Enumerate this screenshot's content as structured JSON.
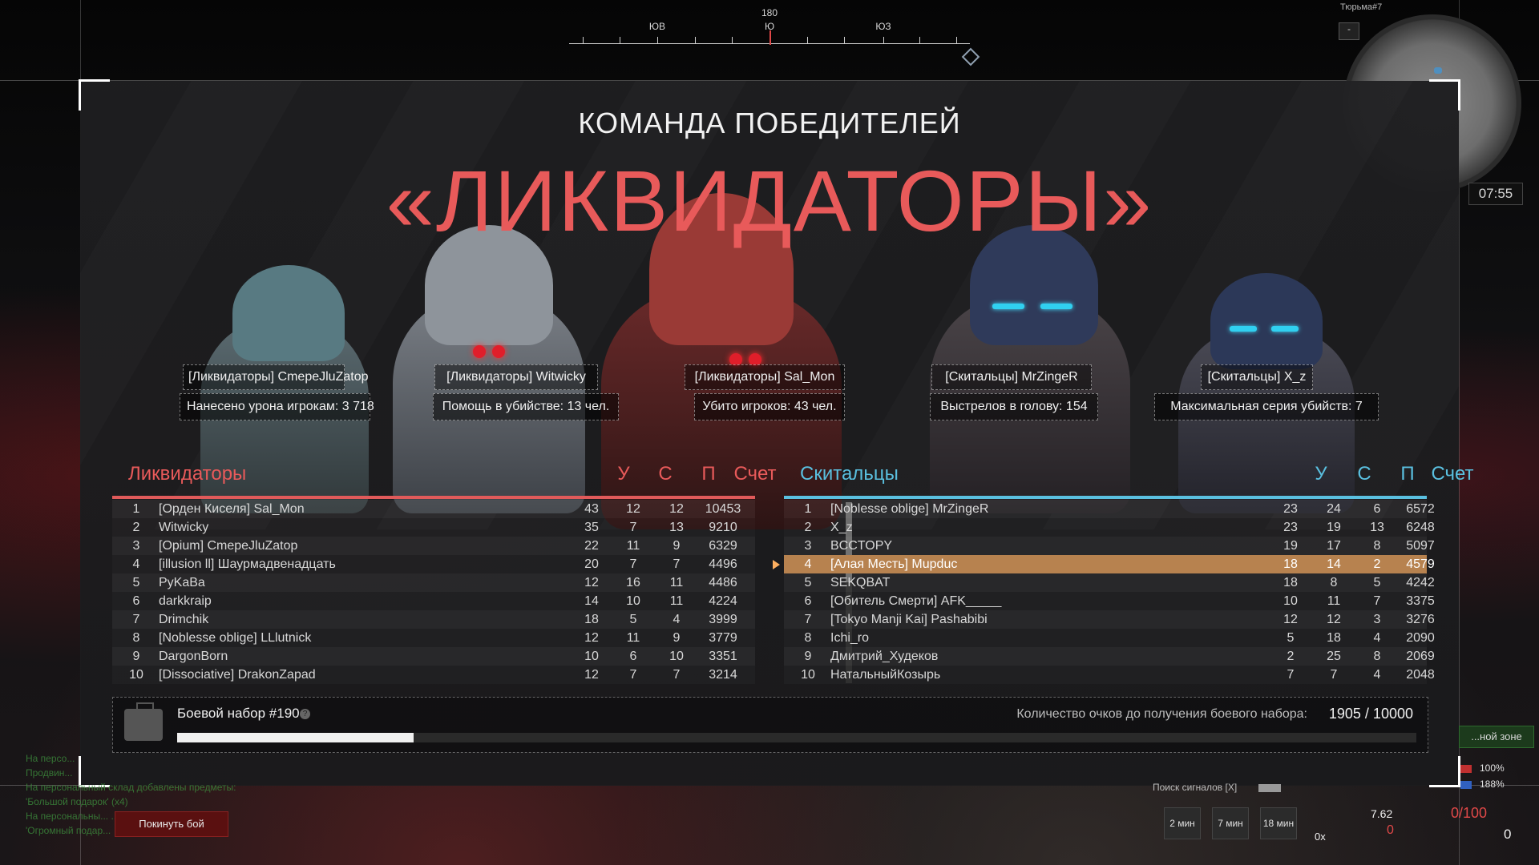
{
  "compass": {
    "heading": "180",
    "labels": [
      {
        "text": "ЮВ"
      },
      {
        "text": "Ю"
      },
      {
        "text": "ЮЗ"
      }
    ]
  },
  "minimap": {
    "location": "Тюрьма#7",
    "button": "-",
    "timer": "07:55"
  },
  "banner": {
    "subtitle": "КОМАНДА ПОБЕДИТЕЛЕЙ",
    "team": "«ЛИКВИДАТОРЫ»"
  },
  "highlights": [
    {
      "player": "[Ликвидаторы] CmepeJluZatop",
      "stat": "Нанесено урона игрокам: 3 718"
    },
    {
      "player": "[Ликвидаторы] Witwicky",
      "stat": "Помощь в убийстве: 13 чел."
    },
    {
      "player": "[Ликвидаторы] Sal_Mon",
      "stat": "Убито игроков: 43 чел."
    },
    {
      "player": "[Скитальцы] MrZingeR",
      "stat": "Выстрелов в голову: 154"
    },
    {
      "player": "[Скитальцы] X_z",
      "stat": "Максимальная серия убийств: 7"
    }
  ],
  "columns": {
    "kills": "У",
    "deaths": "С",
    "assists": "П",
    "score": "Счет"
  },
  "team_left": {
    "name": "Ликвидаторы",
    "color": "#e05a5a",
    "rows": [
      {
        "rank": "1",
        "name": "[Орден Киселя] Sal_Mon",
        "k": "43",
        "d": "12",
        "a": "12",
        "score": "10453"
      },
      {
        "rank": "2",
        "name": "Witwicky",
        "k": "35",
        "d": "7",
        "a": "13",
        "score": "9210"
      },
      {
        "rank": "3",
        "name": "[Opium] CmepeJluZatop",
        "k": "22",
        "d": "11",
        "a": "9",
        "score": "6329"
      },
      {
        "rank": "4",
        "name": "[illusion ll] Шаурмадвенадцать",
        "k": "20",
        "d": "7",
        "a": "7",
        "score": "4496"
      },
      {
        "rank": "5",
        "name": "PyKaBa",
        "k": "12",
        "d": "16",
        "a": "11",
        "score": "4486"
      },
      {
        "rank": "6",
        "name": "darkkraip",
        "k": "14",
        "d": "10",
        "a": "11",
        "score": "4224"
      },
      {
        "rank": "7",
        "name": "Drimchik",
        "k": "18",
        "d": "5",
        "a": "4",
        "score": "3999"
      },
      {
        "rank": "8",
        "name": "[Noblesse oblige] LLlutnick",
        "k": "12",
        "d": "11",
        "a": "9",
        "score": "3779"
      },
      {
        "rank": "9",
        "name": "DargonBorn",
        "k": "10",
        "d": "6",
        "a": "10",
        "score": "3351"
      },
      {
        "rank": "10",
        "name": "[Dissociative] DrakonZapad",
        "k": "12",
        "d": "7",
        "a": "7",
        "score": "3214"
      }
    ]
  },
  "team_right": {
    "name": "Скитальцы",
    "color": "#5ac0e0",
    "highlight_color": "#b7824f",
    "rows": [
      {
        "rank": "1",
        "name": "[Noblesse oblige] MrZingeR",
        "k": "23",
        "d": "24",
        "a": "6",
        "score": "6572"
      },
      {
        "rank": "2",
        "name": "X_z",
        "k": "23",
        "d": "19",
        "a": "13",
        "score": "6248"
      },
      {
        "rank": "3",
        "name": "BCCTOPY",
        "k": "19",
        "d": "17",
        "a": "8",
        "score": "5097"
      },
      {
        "rank": "4",
        "name": "[Алая Месть] Mupduc",
        "k": "18",
        "d": "14",
        "a": "2",
        "score": "4579"
      },
      {
        "rank": "5",
        "name": "SEKQBAT",
        "k": "18",
        "d": "8",
        "a": "5",
        "score": "4242"
      },
      {
        "rank": "6",
        "name": "[Обитель Смерти] AFK_____",
        "k": "10",
        "d": "11",
        "a": "7",
        "score": "3375"
      },
      {
        "rank": "7",
        "name": "[Tokyo Manji Kai] Pashabibi",
        "k": "12",
        "d": "12",
        "a": "3",
        "score": "3276"
      },
      {
        "rank": "8",
        "name": "Ichi_ro",
        "k": "5",
        "d": "18",
        "a": "4",
        "score": "2090"
      },
      {
        "rank": "9",
        "name": "Дмитрий_Худеков",
        "k": "2",
        "d": "25",
        "a": "8",
        "score": "2069"
      },
      {
        "rank": "10",
        "name": "НатальныйКозырь",
        "k": "7",
        "d": "7",
        "a": "4",
        "score": "2048"
      }
    ]
  },
  "battle_pack": {
    "title": "Боевой набор #190",
    "help": "?",
    "progress_label": "Количество очков до получения боевого набора:",
    "progress_text": "1905 / 10000",
    "progress_fraction": 0.1905
  },
  "hud": {
    "leave_button": "Покинуть бой",
    "chat_lines": [
      "На персо...",
      "Продвин...",
      "На персональный склад добавлены предметы:",
      "'Большой подарок' (x4)",
      "На персональны...                                   ...редметы:",
      "'Огромный подар..."
    ],
    "zone_badge": "...ной зоне",
    "health_pct": "100%",
    "armor_pct": "188%",
    "signal_search": "Поиск сигналов [X]",
    "timer_buttons": [
      "2 мин",
      "7 мин",
      "18 мин"
    ],
    "caliber": "7.62",
    "caliber_zero": "0",
    "ammo": "0/100",
    "ammo_reserve": "0",
    "zoom": "0x"
  }
}
